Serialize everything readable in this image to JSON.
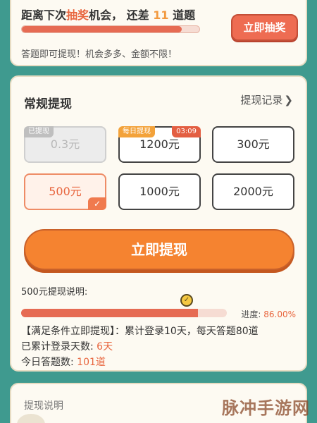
{
  "lottery": {
    "prefix": "距离下次",
    "keyword": "抽奖",
    "middle": "机会，",
    "remain_prefix": "还差",
    "remain_count": "11",
    "remain_suffix": "道题",
    "progress": 0.9,
    "button_label": "立即抽奖",
    "subtitle": "答题即可提现！机会多多、金额不限！"
  },
  "withdraw": {
    "title": "常规提现",
    "records_label": "提现记录",
    "amounts": [
      {
        "label": "0.3元",
        "tag": "已提现",
        "state": "disabled"
      },
      {
        "label": "1200元",
        "tag": "每日提现",
        "timer": "03:09",
        "state": "normal"
      },
      {
        "label": "300元",
        "state": "normal"
      },
      {
        "label": "500元",
        "state": "selected"
      },
      {
        "label": "1000元",
        "state": "normal"
      },
      {
        "label": "2000元",
        "state": "normal"
      }
    ],
    "button_label": "立即提现",
    "explain_title": "500元提现说明:",
    "progress": 0.86,
    "progress_prefix": "进度: ",
    "progress_text": "86.00%",
    "condition_line": "【满足条件立即提现】：累计登录10天，每天答题80道",
    "login_days_label": "已累计登录天数:",
    "login_days_value": "6天",
    "today_answers_label": "今日答题数:",
    "today_answers_value": "101道"
  },
  "bottom": {
    "title": "提现说明",
    "watermark": "脉冲手游网"
  },
  "colors": {
    "background": "#3f9a8f",
    "accent": "#e8663f",
    "button_orange": "#f58330",
    "lottery_red": "#ee6c52"
  }
}
